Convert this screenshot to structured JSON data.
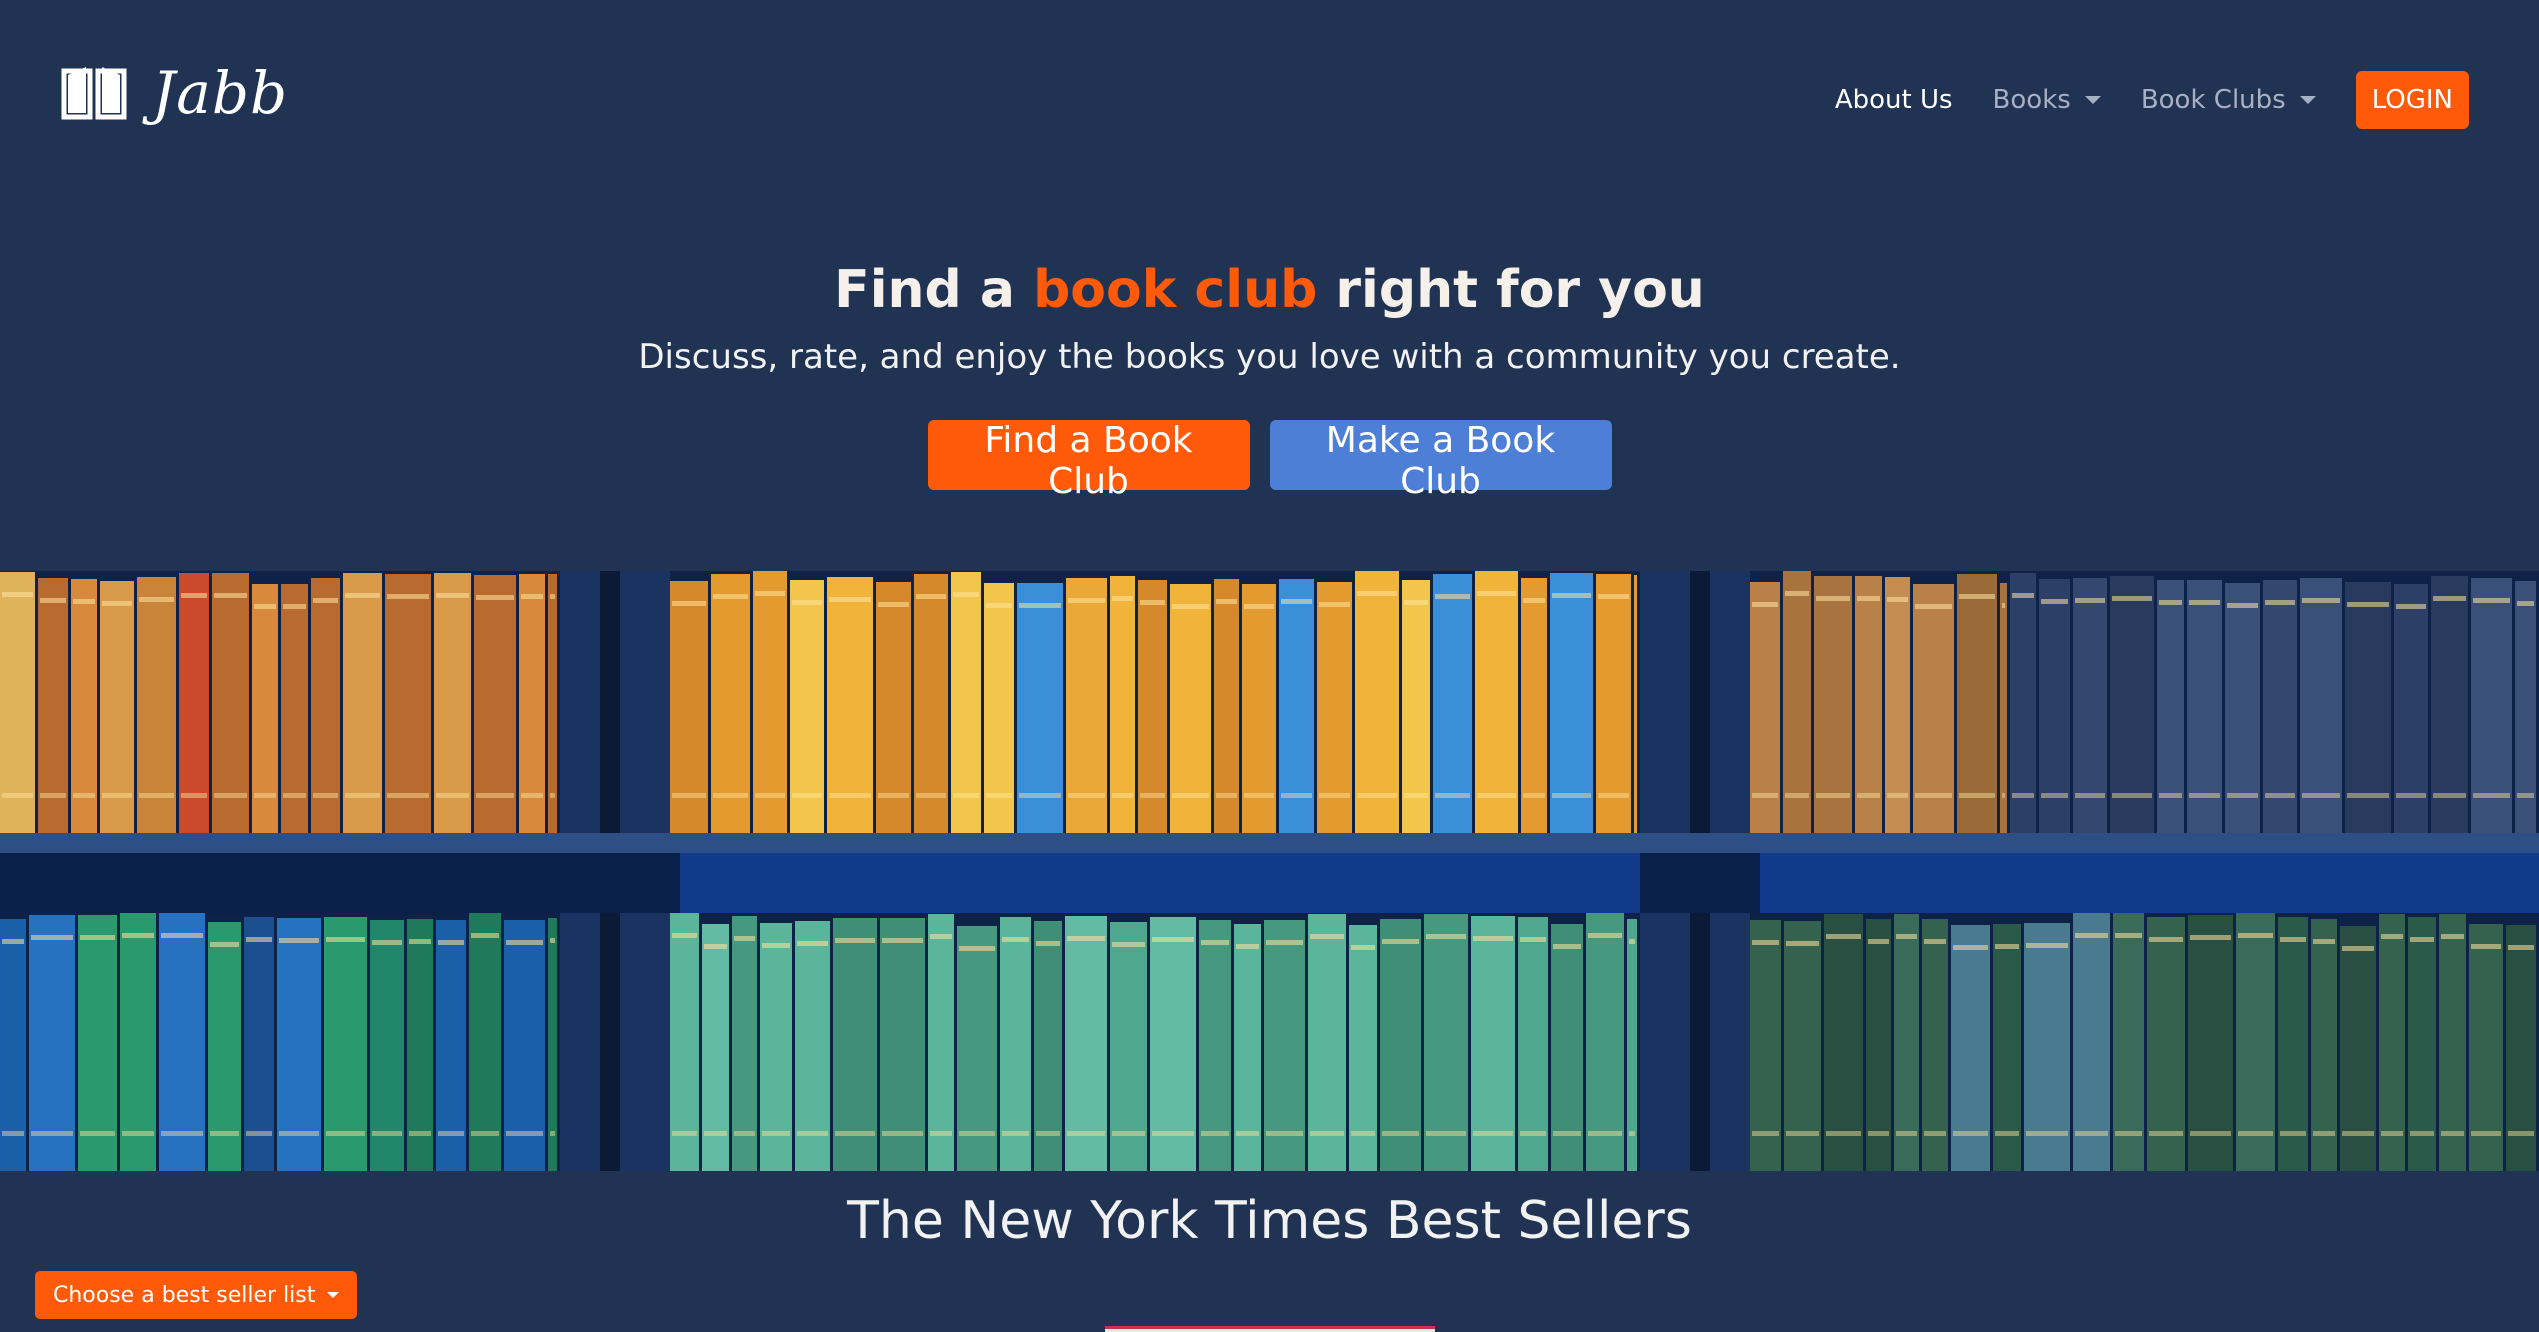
{
  "brand": {
    "name": "Jabb",
    "icon": "open-book-icon"
  },
  "nav": {
    "about": "About Us",
    "books": "Books",
    "book_clubs": "Book Clubs",
    "login": "LOGIN"
  },
  "hero": {
    "title_prefix": "Find a ",
    "title_accent": "book club",
    "title_suffix": " right for you",
    "subtitle": "Discuss, rate, and enjoy the books you love with a community you create.",
    "find_button": "Find a Book Club",
    "make_button": "Make a Book Club"
  },
  "best_sellers": {
    "title": "The New York Times Best Sellers",
    "dropdown_label": "Choose a best seller list"
  },
  "colors": {
    "background": "#213353",
    "accent_orange": "#ff5a0a",
    "accent_blue": "#4d7fd6",
    "nav_inactive": "#a7b1c3"
  }
}
